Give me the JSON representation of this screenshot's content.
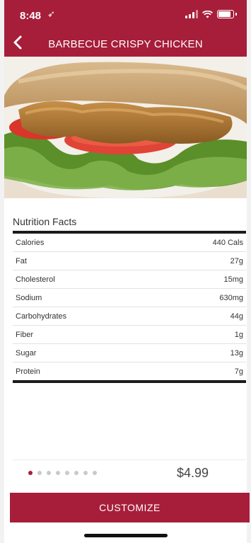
{
  "status_bar": {
    "time": "8:48",
    "location_glyph": "➶"
  },
  "header": {
    "title": "BARBECUE CRISPY CHICKEN",
    "back_icon": "chevron-left-icon"
  },
  "nutrition": {
    "title": "Nutrition Facts",
    "rows": [
      {
        "label": "Calories",
        "value": "440 Cals"
      },
      {
        "label": "Fat",
        "value": "27g"
      },
      {
        "label": "Cholesterol",
        "value": "15mg"
      },
      {
        "label": "Sodium",
        "value": "630mg"
      },
      {
        "label": "Carbohydrates",
        "value": "44g"
      },
      {
        "label": "Fiber",
        "value": "1g"
      },
      {
        "label": "Sugar",
        "value": "13g"
      },
      {
        "label": "Protein",
        "value": "7g"
      }
    ]
  },
  "pager": {
    "count": 8,
    "active_index": 0
  },
  "price": "$4.99",
  "customize_label": "CUSTOMIZE",
  "colors": {
    "brand": "#a61e3a"
  }
}
